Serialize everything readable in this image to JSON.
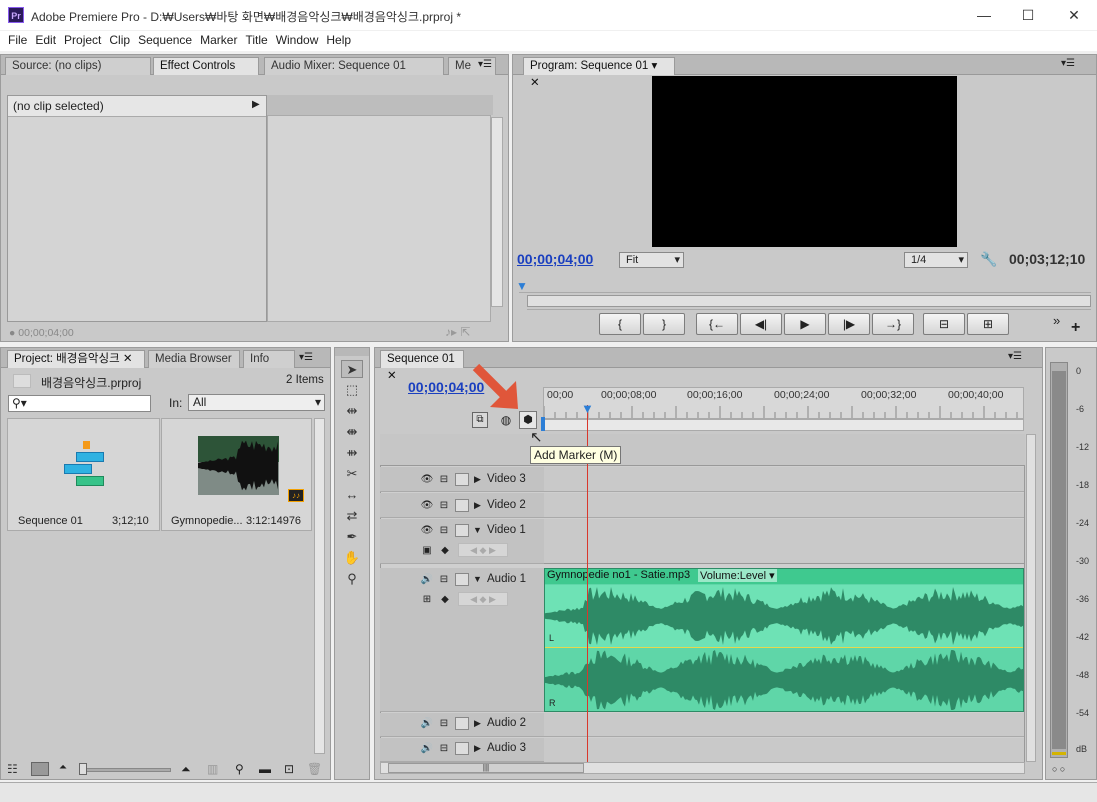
{
  "window": {
    "title": "Adobe Premiere Pro - D:₩Users₩바탕 화면₩배경음악싱크₩배경음악싱크.prproj *",
    "app_icon": "Pr"
  },
  "menu": [
    "File",
    "Edit",
    "Project",
    "Clip",
    "Sequence",
    "Marker",
    "Title",
    "Window",
    "Help"
  ],
  "source_panel": {
    "tabs": [
      "Source: (no clips)",
      "Effect Controls",
      "Audio Mixer: Sequence 01",
      "Me"
    ],
    "clip_label": "(no clip selected)",
    "timecode": "00;00;04;00"
  },
  "program_panel": {
    "tab": "Program: Sequence 01",
    "timecode": "00;00;04;00",
    "fit_label": "Fit",
    "resolution": "1/4",
    "duration": "00;03;12;10",
    "buttons": [
      "{",
      "}",
      "{←",
      "◀|",
      "▶",
      "|▶",
      "→}"
    ]
  },
  "project_panel": {
    "tabs": [
      "Project: 배경음악싱크",
      "Media Browser",
      "Info"
    ],
    "file": "배경음악싱크.prproj",
    "items_count": "2 Items",
    "in_label": "In:",
    "in_value": "All",
    "items": [
      {
        "name": "Sequence 01",
        "duration": "3;12;10"
      },
      {
        "name": "Gymnopedie...",
        "duration": "3:12:14976"
      }
    ]
  },
  "timeline": {
    "tab": "Sequence 01",
    "timecode": "00;00;04;00",
    "ruler": [
      "00;00",
      "00;00;08;00",
      "00;00;16;00",
      "00;00;24;00",
      "00;00;32;00",
      "00;00;40;00"
    ],
    "tooltip": "Add Marker (M)",
    "tracks": {
      "video3": "Video 3",
      "video2": "Video 2",
      "video1": "Video 1",
      "audio1": "Audio 1",
      "audio2": "Audio 2",
      "audio3": "Audio 3"
    },
    "clip": {
      "name": "Gymnopedie no1 - Satie.mp3",
      "volume": "Volume:Level",
      "ch_left": "L",
      "ch_right": "R"
    }
  },
  "meter": {
    "scale": [
      "0",
      "-6",
      "-12",
      "-18",
      "-24",
      "-30",
      "-36",
      "-42",
      "-48",
      "-54",
      "dB"
    ]
  },
  "colors": {
    "accent_timecode": "#1a3fbf",
    "audio_clip": "#5fd6a8",
    "audio_wave": "#2e8a66",
    "playhead": "#d9372c",
    "arrow": "#e0563a"
  }
}
